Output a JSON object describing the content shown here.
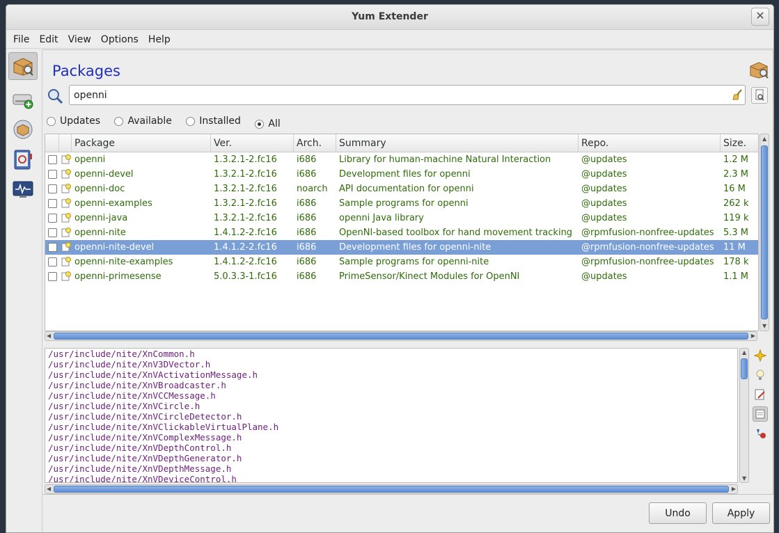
{
  "window": {
    "title": "Yum Extender",
    "close_glyph": "✕"
  },
  "menu": [
    "File",
    "Edit",
    "View",
    "Options",
    "Help"
  ],
  "page": {
    "title": "Packages"
  },
  "search": {
    "value": "openni",
    "placeholder": ""
  },
  "filters": [
    {
      "label": "Updates",
      "checked": false
    },
    {
      "label": "Available",
      "checked": false
    },
    {
      "label": "Installed",
      "checked": false
    },
    {
      "label": "All",
      "checked": true
    }
  ],
  "table": {
    "columns": [
      "Package",
      "Ver.",
      "Arch.",
      "Summary",
      "Repo.",
      "Size."
    ],
    "rows": [
      {
        "name": "openni",
        "ver": "1.3.2.1-2.fc16",
        "arch": "i686",
        "summary": "Library for human-machine Natural Interaction",
        "repo": "@updates",
        "size": "1.2 M"
      },
      {
        "name": "openni-devel",
        "ver": "1.3.2.1-2.fc16",
        "arch": "i686",
        "summary": "Development files for openni",
        "repo": "@updates",
        "size": "2.3 M"
      },
      {
        "name": "openni-doc",
        "ver": "1.3.2.1-2.fc16",
        "arch": "noarch",
        "summary": "API documentation for openni",
        "repo": "@updates",
        "size": "16 M"
      },
      {
        "name": "openni-examples",
        "ver": "1.3.2.1-2.fc16",
        "arch": "i686",
        "summary": "Sample programs for openni",
        "repo": "@updates",
        "size": "262 k"
      },
      {
        "name": "openni-java",
        "ver": "1.3.2.1-2.fc16",
        "arch": "i686",
        "summary": "openni Java library",
        "repo": "@updates",
        "size": "119 k"
      },
      {
        "name": "openni-nite",
        "ver": "1.4.1.2-2.fc16",
        "arch": "i686",
        "summary": "OpenNI-based toolbox for hand movement tracking",
        "repo": "@rpmfusion-nonfree-updates",
        "size": "5.3 M"
      },
      {
        "name": "openni-nite-devel",
        "ver": "1.4.1.2-2.fc16",
        "arch": "i686",
        "summary": "Development files for openni-nite",
        "repo": "@rpmfusion-nonfree-updates",
        "size": "11 M",
        "selected": true
      },
      {
        "name": "openni-nite-examples",
        "ver": "1.4.1.2-2.fc16",
        "arch": "i686",
        "summary": "Sample programs for openni-nite",
        "repo": "@rpmfusion-nonfree-updates",
        "size": "178 k"
      },
      {
        "name": "openni-primesense",
        "ver": "5.0.3.3-1.fc16",
        "arch": "i686",
        "summary": "PrimeSensor/Kinect Modules for OpenNI",
        "repo": "@updates",
        "size": "1.1 M"
      }
    ]
  },
  "files": [
    "/usr/include/nite/XnCommon.h",
    "/usr/include/nite/XnV3DVector.h",
    "/usr/include/nite/XnVActivationMessage.h",
    "/usr/include/nite/XnVBroadcaster.h",
    "/usr/include/nite/XnVCCMessage.h",
    "/usr/include/nite/XnVCircle.h",
    "/usr/include/nite/XnVCircleDetector.h",
    "/usr/include/nite/XnVClickableVirtualPlane.h",
    "/usr/include/nite/XnVComplexMessage.h",
    "/usr/include/nite/XnVDepthControl.h",
    "/usr/include/nite/XnVDepthGenerator.h",
    "/usr/include/nite/XnVDepthMessage.h",
    "/usr/include/nite/XnVDeviceControl.h"
  ],
  "buttons": {
    "undo": "Undo",
    "apply": "Apply"
  },
  "sidebar_icons": [
    "packages-icon",
    "add-repo-icon",
    "groups-icon",
    "history-icon",
    "monitor-icon"
  ],
  "detail_tools": [
    "description-icon",
    "hint-icon",
    "changelog-icon",
    "files-icon",
    "dependencies-icon"
  ],
  "colors": {
    "accent": "#1f2fbf",
    "selection": "#7a9fd7",
    "package_text": "#2f6c0a",
    "file_text": "#6b1f7a"
  }
}
